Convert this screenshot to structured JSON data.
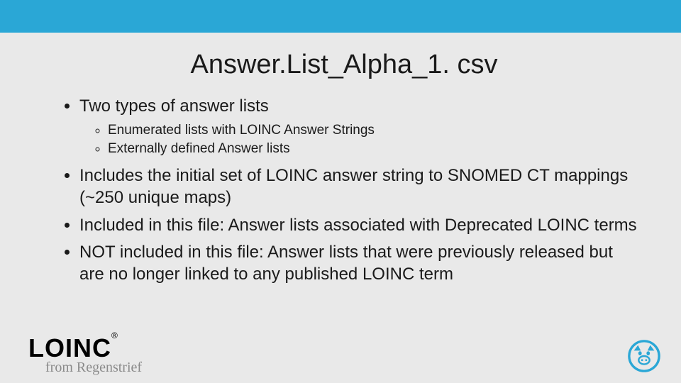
{
  "title": "Answer.List_Alpha_1. csv",
  "bullets": {
    "b1": "Two types of answer lists",
    "b1_sub1": "Enumerated lists with LOINC Answer Strings",
    "b1_sub2": "Externally defined Answer lists",
    "b2": "Includes the initial set of LOINC answer string to SNOMED CT mappings (~250 unique maps)",
    "b3": "Included in this file: Answer lists associated with Deprecated LOINC terms",
    "b4": "NOT included in this file: Answer lists that were previously released but are no longer linked to any published LOINC term"
  },
  "footer": {
    "logo_text": "LOINC",
    "registered": "®",
    "tagline": "from Regenstrief"
  },
  "colors": {
    "accent": "#2aa7d6",
    "background": "#e9e9e9"
  }
}
